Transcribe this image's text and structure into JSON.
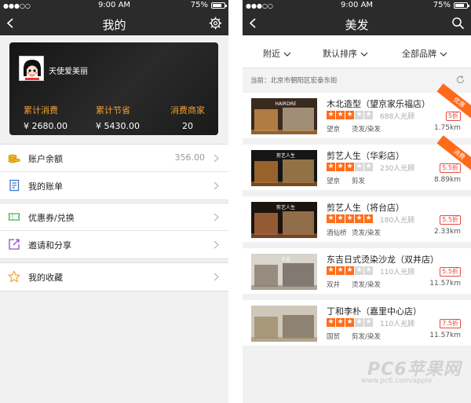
{
  "status_bar": {
    "left": {
      "signal": "●●●○○",
      "time": "9:00 AM",
      "battery": "75%"
    },
    "right": {
      "signal": "●●●○○",
      "time": "9:00 AM",
      "battery": "75%"
    }
  },
  "profile_screen": {
    "title": "我的",
    "username": "天使爱美丽",
    "stats": [
      {
        "label": "累计消费",
        "value": "¥ 2680.00"
      },
      {
        "label": "累计节省",
        "value": "¥ 5430.00"
      },
      {
        "label": "消费商家",
        "value": "20"
      }
    ],
    "menu_groups": [
      [
        {
          "label": "账户余额",
          "value": "356.00",
          "icon": "coins-icon"
        },
        {
          "label": "我的账单",
          "value": "",
          "icon": "bill-icon"
        }
      ],
      [
        {
          "label": "优惠券/兑换",
          "value": "",
          "icon": "ticket-icon"
        },
        {
          "label": "邀请和分享",
          "value": "",
          "icon": "share-icon"
        }
      ],
      [
        {
          "label": "我的收藏",
          "value": "",
          "icon": "star-icon"
        }
      ]
    ],
    "colors": {
      "accent": "#f0a030",
      "card_bg": "#1b1b1b"
    }
  },
  "list_screen": {
    "title": "美发",
    "filters": [
      "附近",
      "默认排序",
      "全部品牌"
    ],
    "location": "当前：北京市朝阳区宏泰东街",
    "shops": [
      {
        "name": "木北造型（望京家乐福店）",
        "stars": 3,
        "count": "688人光顾",
        "badge": "5折",
        "area": "望京",
        "cats": "烫发/染发",
        "distance": "1.75km",
        "ribbon": "优惠"
      },
      {
        "name": "剪艺人生（华彩店）",
        "stars": 3,
        "count": "230人光顾",
        "badge": "5.5折",
        "area": "望京",
        "cats": "剪发",
        "distance": "8.89km",
        "ribbon": "消费"
      },
      {
        "name": "剪艺人生（将台店）",
        "stars": 5,
        "count": "180人光顾",
        "badge": "5.5折",
        "area": "酒仙桥",
        "cats": "烫发/染发",
        "distance": "2.33km",
        "ribbon": ""
      },
      {
        "name": "东吉日式烫染沙龙（双井店）",
        "stars": 3,
        "count": "110人光顾",
        "badge": "5.5折",
        "area": "双井",
        "cats": "烫发/染发",
        "distance": "11.57km",
        "ribbon": ""
      },
      {
        "name": "丁和李朴（嘉里中心店）",
        "stars": 3,
        "count": "110人光顾",
        "badge": "7.5折",
        "area": "国贸",
        "cats": "剪发/染发",
        "distance": "11.57km",
        "ribbon": ""
      }
    ],
    "thumb_signs": [
      "HAIRDRE",
      "剪艺人生",
      "剪艺人生",
      "东吉",
      ""
    ],
    "colors": {
      "accent": "#ff6e1a",
      "badge": "#e84a3c"
    }
  },
  "watermark": {
    "brand": "PC6苹果网",
    "url": "www.pc6.com/apple"
  }
}
